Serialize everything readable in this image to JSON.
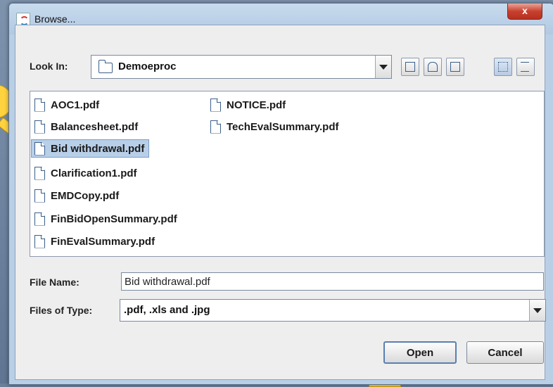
{
  "window": {
    "title": "Browse...",
    "close_glyph": "x"
  },
  "look_in": {
    "label": "Look In:",
    "value": "Demoeproc"
  },
  "toolbar": {
    "icons": [
      "up-folder-icon",
      "home-icon",
      "new-folder-icon",
      "list-view-icon",
      "details-view-icon"
    ]
  },
  "files": {
    "col1": [
      "AOC1.pdf",
      "Balancesheet.pdf",
      "Bid withdrawal.pdf",
      "Clarification1.pdf",
      "EMDCopy.pdf",
      "FinBidOpenSummary.pdf",
      "FinEvalSummary.pdf"
    ],
    "col2": [
      "NOTICE.pdf",
      "TechEvalSummary.pdf"
    ],
    "selected": "Bid withdrawal.pdf"
  },
  "file_name": {
    "label": "File Name:",
    "value": "Bid withdrawal.pdf"
  },
  "files_of_type": {
    "label": "Files of Type:",
    "value": ".pdf, .xls and .jpg"
  },
  "buttons": {
    "open": "Open",
    "cancel": "Cancel"
  },
  "colors": {
    "selection": "#b8cfe8",
    "callout": "#ffd23f",
    "close": "#c8412f"
  }
}
